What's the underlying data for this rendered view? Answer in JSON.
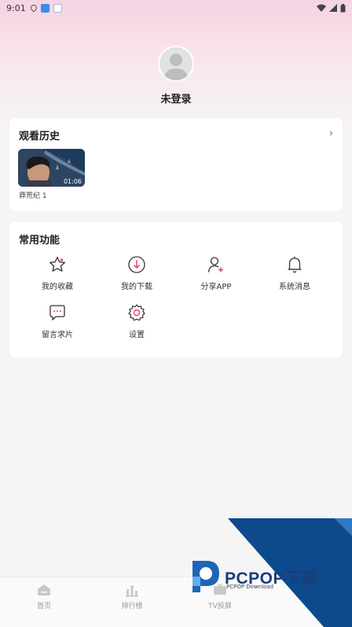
{
  "status_bar": {
    "time": "9:01"
  },
  "profile": {
    "username": "未登录"
  },
  "history": {
    "title": "观看历史",
    "arrow": "›",
    "items": [
      {
        "label": "莽荒纪 1",
        "duration": "01:06"
      }
    ]
  },
  "functions": {
    "title": "常用功能",
    "items": [
      {
        "label": "我的收藏",
        "icon": "star-icon"
      },
      {
        "label": "我的下载",
        "icon": "download-icon"
      },
      {
        "label": "分享APP",
        "icon": "share-user-icon"
      },
      {
        "label": "系统消息",
        "icon": "bell-icon"
      },
      {
        "label": "留言求片",
        "icon": "message-icon"
      },
      {
        "label": "设置",
        "icon": "gear-icon"
      }
    ]
  },
  "tabs": [
    {
      "label": "首页",
      "icon": "home-icon"
    },
    {
      "label": "排行榜",
      "icon": "chart-icon"
    },
    {
      "label": "TV投屏",
      "icon": "tv-icon"
    }
  ],
  "watermark": {
    "brand": "PCPOP下载",
    "sub": "PCPOP Download"
  },
  "colors": {
    "accent": "#e0407a",
    "header_pink": "#f6d3e2",
    "watermark_blue": "#0d4a8c"
  }
}
